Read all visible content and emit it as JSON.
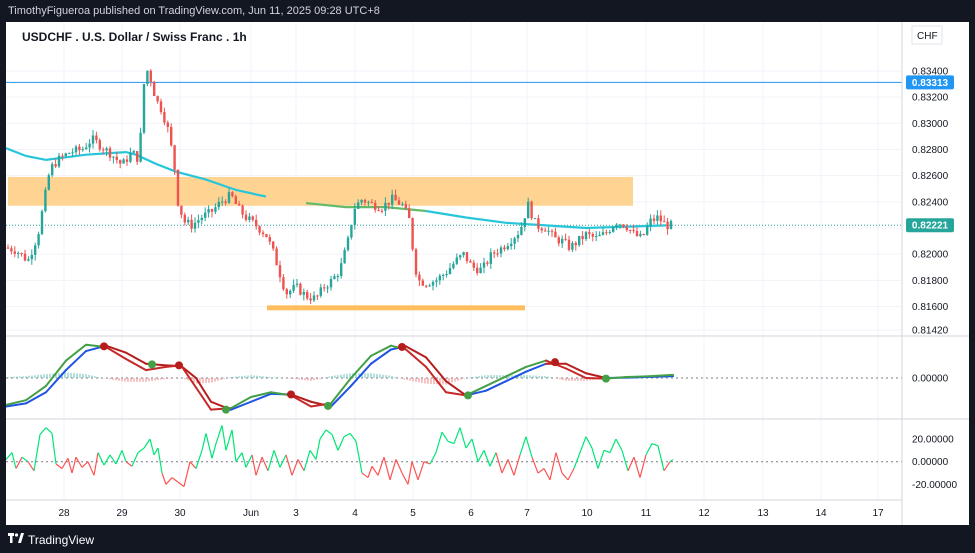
{
  "header": {
    "published_text": "TimothyFigueroa published on TradingView.com, Jun 11, 2025 09:28 UTC+8"
  },
  "footer": {
    "brand": "TradingView"
  },
  "colors": {
    "background": "#ffffff",
    "up": "#26a69a",
    "down": "#ef5350",
    "ma": "#26c6da",
    "zone": "#ffcc80",
    "support": "#ffb74d",
    "alert_line": "#2196f3",
    "price_label": "#2196f3",
    "current_label": "#26a69a",
    "macd_fast": "#43a047",
    "macd_slow": "#1e53e5",
    "cross_up": "#43a047",
    "cross_down": "#b71c1c",
    "osc_up": "#00e676",
    "osc_down": "#ff5252"
  },
  "chart_data": [
    {
      "type": "candlestick",
      "title": "USDCHF . U.S. Dollar / Swiss Franc . 1h",
      "currency": "CHF",
      "x_tick_labels": [
        "28",
        "29",
        "30",
        "Jun",
        "3",
        "4",
        "5",
        "6",
        "7",
        "10",
        "11",
        "12",
        "13",
        "14",
        "17"
      ],
      "y_tick_labels": [
        "0.83400",
        "0.83200",
        "0.83000",
        "0.82800",
        "0.82600",
        "0.82400",
        "0.82200",
        "0.82000",
        "0.81800",
        "0.81600",
        "0.81420"
      ],
      "ylim": [
        0.8139,
        0.8356
      ],
      "horizontal_line": {
        "value": 0.83313,
        "label": "0.83313"
      },
      "current_price": {
        "value": 0.82221,
        "label": "0.82221"
      },
      "resistance_zone": [
        0.8237,
        0.8259
      ],
      "support_level": 0.8159,
      "moving_average": [
        [
          0,
          0.8281
        ],
        [
          20,
          0.8275
        ],
        [
          40,
          0.8272
        ],
        [
          60,
          0.8274
        ],
        [
          80,
          0.8276
        ],
        [
          100,
          0.8277
        ],
        [
          120,
          0.8278
        ],
        [
          130,
          0.8276
        ],
        [
          150,
          0.8269
        ],
        [
          170,
          0.8263
        ],
        [
          200,
          0.8257
        ],
        [
          230,
          0.8249
        ],
        [
          260,
          0.8244
        ],
        [
          300,
          0.8239
        ],
        [
          340,
          0.8236
        ],
        [
          380,
          0.8236
        ],
        [
          420,
          0.8233
        ],
        [
          460,
          0.8228
        ],
        [
          500,
          0.8224
        ],
        [
          540,
          0.8222
        ],
        [
          580,
          0.822
        ],
        [
          620,
          0.8221
        ],
        [
          660,
          0.8222
        ]
      ],
      "price_path": [
        [
          0,
          0.8205
        ],
        [
          10,
          0.8203
        ],
        [
          22,
          0.8195
        ],
        [
          32,
          0.8215
        ],
        [
          38,
          0.824
        ],
        [
          44,
          0.8265
        ],
        [
          52,
          0.8272
        ],
        [
          64,
          0.8278
        ],
        [
          76,
          0.828
        ],
        [
          86,
          0.8288
        ],
        [
          96,
          0.8282
        ],
        [
          106,
          0.8276
        ],
        [
          116,
          0.8268
        ],
        [
          126,
          0.8278
        ],
        [
          133,
          0.8272
        ],
        [
          138,
          0.833
        ],
        [
          142,
          0.8342
        ],
        [
          150,
          0.8318
        ],
        [
          156,
          0.831
        ],
        [
          162,
          0.8295
        ],
        [
          168,
          0.827
        ],
        [
          172,
          0.824
        ],
        [
          178,
          0.8225
        ],
        [
          186,
          0.8222
        ],
        [
          195,
          0.8228
        ],
        [
          205,
          0.8232
        ],
        [
          215,
          0.824
        ],
        [
          225,
          0.8245
        ],
        [
          232,
          0.8235
        ],
        [
          240,
          0.8228
        ],
        [
          250,
          0.8222
        ],
        [
          260,
          0.8215
        ],
        [
          268,
          0.82
        ],
        [
          274,
          0.8185
        ],
        [
          280,
          0.817
        ],
        [
          290,
          0.8175
        ],
        [
          300,
          0.8168
        ],
        [
          310,
          0.8166
        ],
        [
          318,
          0.8175
        ],
        [
          326,
          0.818
        ],
        [
          334,
          0.8188
        ],
        [
          342,
          0.821
        ],
        [
          348,
          0.8235
        ],
        [
          356,
          0.8242
        ],
        [
          366,
          0.8238
        ],
        [
          376,
          0.8236
        ],
        [
          386,
          0.8242
        ],
        [
          396,
          0.8238
        ],
        [
          404,
          0.8225
        ],
        [
          408,
          0.8195
        ],
        [
          412,
          0.818
        ],
        [
          420,
          0.8178
        ],
        [
          430,
          0.818
        ],
        [
          440,
          0.8186
        ],
        [
          450,
          0.8195
        ],
        [
          458,
          0.82
        ],
        [
          466,
          0.819
        ],
        [
          476,
          0.8188
        ],
        [
          486,
          0.82
        ],
        [
          496,
          0.8205
        ],
        [
          506,
          0.8212
        ],
        [
          514,
          0.8218
        ],
        [
          522,
          0.8238
        ],
        [
          530,
          0.8222
        ],
        [
          540,
          0.822
        ],
        [
          548,
          0.8212
        ],
        [
          556,
          0.821
        ],
        [
          564,
          0.8205
        ],
        [
          572,
          0.821
        ],
        [
          580,
          0.8215
        ],
        [
          590,
          0.8212
        ],
        [
          600,
          0.8216
        ],
        [
          610,
          0.8225
        ],
        [
          620,
          0.8222
        ],
        [
          628,
          0.8215
        ],
        [
          636,
          0.8212
        ],
        [
          644,
          0.8225
        ],
        [
          652,
          0.8228
        ],
        [
          660,
          0.8222
        ],
        [
          667,
          0.8222
        ]
      ]
    },
    {
      "type": "line",
      "name": "momentum-oscillator",
      "y_tick_labels": [
        "0.00000"
      ],
      "ylim": [
        -1.2,
        1.2
      ],
      "fast_line": [
        [
          0,
          -0.85
        ],
        [
          20,
          -0.7
        ],
        [
          40,
          -0.25
        ],
        [
          60,
          0.55
        ],
        [
          80,
          1.05
        ],
        [
          100,
          0.98
        ],
        [
          120,
          0.6
        ],
        [
          140,
          0.25
        ],
        [
          160,
          0.35
        ],
        [
          175,
          0.4
        ],
        [
          190,
          -0.3
        ],
        [
          205,
          -1.0
        ],
        [
          225,
          -0.95
        ],
        [
          245,
          -0.6
        ],
        [
          265,
          -0.45
        ],
        [
          285,
          -0.55
        ],
        [
          305,
          -0.9
        ],
        [
          325,
          -0.8
        ],
        [
          345,
          0.0
        ],
        [
          365,
          0.7
        ],
        [
          385,
          1.02
        ],
        [
          400,
          0.9
        ],
        [
          420,
          0.35
        ],
        [
          440,
          -0.45
        ],
        [
          460,
          -0.55
        ],
        [
          480,
          -0.25
        ],
        [
          500,
          0.05
        ],
        [
          520,
          0.35
        ],
        [
          540,
          0.55
        ],
        [
          560,
          0.3
        ],
        [
          580,
          0.0
        ],
        [
          600,
          -0.02
        ],
        [
          620,
          0.03
        ],
        [
          640,
          0.05
        ],
        [
          667,
          0.1
        ]
      ],
      "slow_line": [
        [
          0,
          -0.9
        ],
        [
          20,
          -0.8
        ],
        [
          40,
          -0.45
        ],
        [
          60,
          0.25
        ],
        [
          80,
          0.85
        ],
        [
          100,
          1.02
        ],
        [
          120,
          0.8
        ],
        [
          140,
          0.45
        ],
        [
          160,
          0.4
        ],
        [
          175,
          0.38
        ],
        [
          190,
          0.0
        ],
        [
          205,
          -0.75
        ],
        [
          225,
          -1.0
        ],
        [
          245,
          -0.75
        ],
        [
          265,
          -0.5
        ],
        [
          285,
          -0.52
        ],
        [
          305,
          -0.75
        ],
        [
          325,
          -0.9
        ],
        [
          345,
          -0.25
        ],
        [
          365,
          0.45
        ],
        [
          385,
          0.9
        ],
        [
          400,
          1.0
        ],
        [
          420,
          0.65
        ],
        [
          440,
          -0.1
        ],
        [
          460,
          -0.55
        ],
        [
          480,
          -0.4
        ],
        [
          500,
          -0.1
        ],
        [
          520,
          0.2
        ],
        [
          540,
          0.45
        ],
        [
          560,
          0.45
        ],
        [
          580,
          0.15
        ],
        [
          600,
          0.0
        ],
        [
          620,
          0.01
        ],
        [
          640,
          0.03
        ],
        [
          667,
          0.06
        ]
      ],
      "cross_down": [
        [
          98,
          1.0
        ],
        [
          173,
          0.4
        ],
        [
          285,
          -0.52
        ],
        [
          396,
          0.98
        ],
        [
          549,
          0.5
        ]
      ],
      "cross_up": [
        [
          146,
          0.43
        ],
        [
          220,
          -1.0
        ],
        [
          322,
          -0.88
        ],
        [
          462,
          -0.55
        ],
        [
          600,
          -0.02
        ]
      ]
    },
    {
      "type": "line",
      "name": "oscillator-2",
      "y_tick_labels": [
        "20.00000",
        "0.00000",
        "-20.00000"
      ],
      "ylim": [
        -32,
        35
      ],
      "values": [
        [
          0,
          2
        ],
        [
          6,
          8
        ],
        [
          10,
          -6
        ],
        [
          16,
          4
        ],
        [
          22,
          0
        ],
        [
          28,
          -8
        ],
        [
          34,
          24
        ],
        [
          40,
          30
        ],
        [
          46,
          25
        ],
        [
          50,
          -2
        ],
        [
          56,
          -6
        ],
        [
          62,
          3
        ],
        [
          66,
          -10
        ],
        [
          70,
          4
        ],
        [
          76,
          -5
        ],
        [
          82,
          0
        ],
        [
          88,
          -12
        ],
        [
          92,
          8
        ],
        [
          98,
          -3
        ],
        [
          104,
          6
        ],
        [
          110,
          -2
        ],
        [
          116,
          10
        ],
        [
          120,
          0
        ],
        [
          126,
          -4
        ],
        [
          132,
          8
        ],
        [
          138,
          12
        ],
        [
          144,
          20
        ],
        [
          148,
          6
        ],
        [
          152,
          12
        ],
        [
          156,
          -10
        ],
        [
          160,
          -20
        ],
        [
          166,
          -14
        ],
        [
          172,
          -18
        ],
        [
          178,
          -22
        ],
        [
          184,
          0
        ],
        [
          190,
          -6
        ],
        [
          196,
          10
        ],
        [
          200,
          25
        ],
        [
          206,
          3
        ],
        [
          210,
          16
        ],
        [
          216,
          32
        ],
        [
          220,
          10
        ],
        [
          226,
          28
        ],
        [
          230,
          0
        ],
        [
          236,
          8
        ],
        [
          240,
          -5
        ],
        [
          246,
          6
        ],
        [
          250,
          -12
        ],
        [
          256,
          4
        ],
        [
          262,
          -8
        ],
        [
          268,
          10
        ],
        [
          274,
          -5
        ],
        [
          280,
          6
        ],
        [
          286,
          -12
        ],
        [
          292,
          2
        ],
        [
          298,
          -8
        ],
        [
          304,
          10
        ],
        [
          310,
          2
        ],
        [
          314,
          20
        ],
        [
          320,
          28
        ],
        [
          326,
          24
        ],
        [
          332,
          10
        ],
        [
          338,
          22
        ],
        [
          344,
          25
        ],
        [
          350,
          18
        ],
        [
          356,
          -10
        ],
        [
          362,
          -14
        ],
        [
          366,
          -4
        ],
        [
          372,
          -12
        ],
        [
          378,
          4
        ],
        [
          384,
          -16
        ],
        [
          390,
          2
        ],
        [
          396,
          -10
        ],
        [
          402,
          -20
        ],
        [
          406,
          0
        ],
        [
          412,
          -16
        ],
        [
          418,
          0
        ],
        [
          424,
          -2
        ],
        [
          430,
          8
        ],
        [
          436,
          26
        ],
        [
          442,
          18
        ],
        [
          448,
          16
        ],
        [
          454,
          30
        ],
        [
          460,
          12
        ],
        [
          466,
          20
        ],
        [
          472,
          0
        ],
        [
          478,
          10
        ],
        [
          484,
          -4
        ],
        [
          490,
          8
        ],
        [
          496,
          -10
        ],
        [
          502,
          2
        ],
        [
          508,
          -12
        ],
        [
          514,
          6
        ],
        [
          520,
          22
        ],
        [
          526,
          4
        ],
        [
          532,
          -10
        ],
        [
          538,
          -6
        ],
        [
          544,
          -16
        ],
        [
          550,
          8
        ],
        [
          556,
          -10
        ],
        [
          562,
          -16
        ],
        [
          568,
          -6
        ],
        [
          574,
          8
        ],
        [
          580,
          22
        ],
        [
          586,
          12
        ],
        [
          592,
          -6
        ],
        [
          598,
          10
        ],
        [
          604,
          8
        ],
        [
          610,
          20
        ],
        [
          616,
          10
        ],
        [
          622,
          -8
        ],
        [
          628,
          4
        ],
        [
          634,
          -14
        ],
        [
          640,
          6
        ],
        [
          646,
          16
        ],
        [
          652,
          14
        ],
        [
          658,
          -8
        ],
        [
          664,
          0
        ],
        [
          667,
          2
        ]
      ]
    }
  ]
}
